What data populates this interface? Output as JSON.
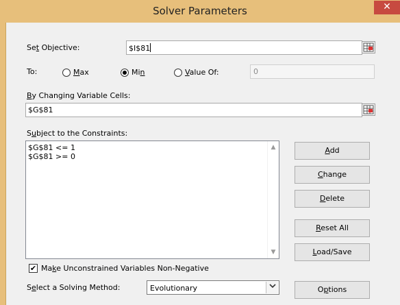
{
  "window": {
    "title": "Solver Parameters",
    "close_glyph": "✕"
  },
  "objective": {
    "label_pre": "Se",
    "label_ul": "t",
    "label_post": " Objective:",
    "value": "$I$81"
  },
  "to": {
    "label": "To:",
    "options": [
      {
        "pre": "",
        "ul": "M",
        "post": "ax",
        "selected": false
      },
      {
        "pre": "Mi",
        "ul": "n",
        "post": "",
        "selected": true
      },
      {
        "pre": "",
        "ul": "V",
        "post": "alue Of:",
        "selected": false
      }
    ],
    "value_of": "0"
  },
  "changing_cells": {
    "label_pre": "",
    "label_ul": "B",
    "label_post": "y Changing Variable Cells:",
    "value": "$G$81"
  },
  "constraints": {
    "label_pre": "S",
    "label_ul": "u",
    "label_post": "bject to the Constraints:",
    "items": [
      "$G$81 <= 1",
      "$G$81 >= 0"
    ]
  },
  "buttons": {
    "add": {
      "pre": "",
      "ul": "A",
      "post": "dd"
    },
    "change": {
      "pre": "",
      "ul": "C",
      "post": "hange"
    },
    "delete": {
      "pre": "",
      "ul": "D",
      "post": "elete"
    },
    "reset_all": {
      "pre": "",
      "ul": "R",
      "post": "eset All"
    },
    "load_save": {
      "pre": "",
      "ul": "L",
      "post": "oad/Save"
    },
    "options": {
      "pre": "O",
      "ul": "p",
      "post": "tions"
    }
  },
  "nonneg": {
    "checked": true,
    "check_glyph": "✔",
    "pre": "Ma",
    "ul": "k",
    "post": "e Unconstrained Variables Non-Negative"
  },
  "method": {
    "label_pre": "S",
    "label_ul": "e",
    "label_post": "lect a Solving Method:",
    "value": "Evolutionary"
  },
  "icons": {
    "ref_icon": "range-selector-icon",
    "dropdown_icon": "chevron-down-icon"
  }
}
